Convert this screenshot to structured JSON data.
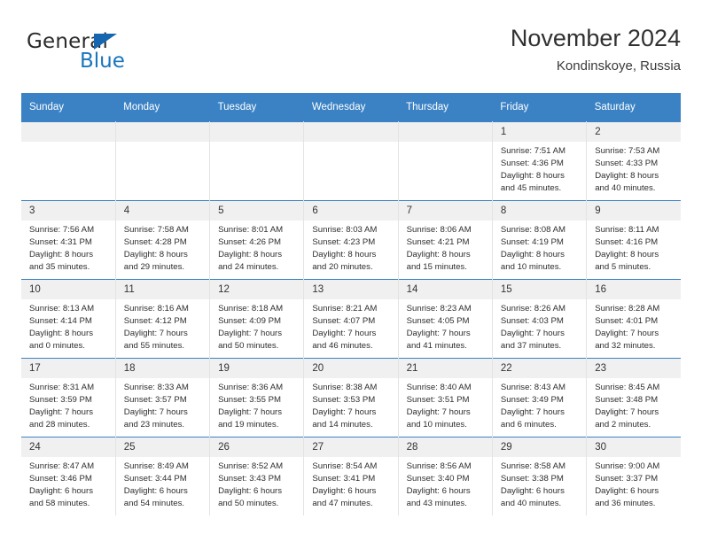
{
  "brand": {
    "word1": "General",
    "word2": "Blue",
    "triangle_color": "#1565b0",
    "blue_color": "#1976bd"
  },
  "header": {
    "title": "November 2024",
    "subtitle": "Kondinskoye, Russia"
  },
  "theme": {
    "header_blue": "#3b82c4",
    "daynum_bg": "#f0f0f0",
    "cell_border": "#e3e3e3"
  },
  "weekdays": [
    "Sunday",
    "Monday",
    "Tuesday",
    "Wednesday",
    "Thursday",
    "Friday",
    "Saturday"
  ],
  "weeks": [
    [
      {
        "day": "",
        "empty": true
      },
      {
        "day": "",
        "empty": true
      },
      {
        "day": "",
        "empty": true
      },
      {
        "day": "",
        "empty": true
      },
      {
        "day": "",
        "empty": true
      },
      {
        "day": "1",
        "sunrise": "Sunrise: 7:51 AM",
        "sunset": "Sunset: 4:36 PM",
        "daylight1": "Daylight: 8 hours",
        "daylight2": "and 45 minutes."
      },
      {
        "day": "2",
        "sunrise": "Sunrise: 7:53 AM",
        "sunset": "Sunset: 4:33 PM",
        "daylight1": "Daylight: 8 hours",
        "daylight2": "and 40 minutes."
      }
    ],
    [
      {
        "day": "3",
        "sunrise": "Sunrise: 7:56 AM",
        "sunset": "Sunset: 4:31 PM",
        "daylight1": "Daylight: 8 hours",
        "daylight2": "and 35 minutes."
      },
      {
        "day": "4",
        "sunrise": "Sunrise: 7:58 AM",
        "sunset": "Sunset: 4:28 PM",
        "daylight1": "Daylight: 8 hours",
        "daylight2": "and 29 minutes."
      },
      {
        "day": "5",
        "sunrise": "Sunrise: 8:01 AM",
        "sunset": "Sunset: 4:26 PM",
        "daylight1": "Daylight: 8 hours",
        "daylight2": "and 24 minutes."
      },
      {
        "day": "6",
        "sunrise": "Sunrise: 8:03 AM",
        "sunset": "Sunset: 4:23 PM",
        "daylight1": "Daylight: 8 hours",
        "daylight2": "and 20 minutes."
      },
      {
        "day": "7",
        "sunrise": "Sunrise: 8:06 AM",
        "sunset": "Sunset: 4:21 PM",
        "daylight1": "Daylight: 8 hours",
        "daylight2": "and 15 minutes."
      },
      {
        "day": "8",
        "sunrise": "Sunrise: 8:08 AM",
        "sunset": "Sunset: 4:19 PM",
        "daylight1": "Daylight: 8 hours",
        "daylight2": "and 10 minutes."
      },
      {
        "day": "9",
        "sunrise": "Sunrise: 8:11 AM",
        "sunset": "Sunset: 4:16 PM",
        "daylight1": "Daylight: 8 hours",
        "daylight2": "and 5 minutes."
      }
    ],
    [
      {
        "day": "10",
        "sunrise": "Sunrise: 8:13 AM",
        "sunset": "Sunset: 4:14 PM",
        "daylight1": "Daylight: 8 hours",
        "daylight2": "and 0 minutes."
      },
      {
        "day": "11",
        "sunrise": "Sunrise: 8:16 AM",
        "sunset": "Sunset: 4:12 PM",
        "daylight1": "Daylight: 7 hours",
        "daylight2": "and 55 minutes."
      },
      {
        "day": "12",
        "sunrise": "Sunrise: 8:18 AM",
        "sunset": "Sunset: 4:09 PM",
        "daylight1": "Daylight: 7 hours",
        "daylight2": "and 50 minutes."
      },
      {
        "day": "13",
        "sunrise": "Sunrise: 8:21 AM",
        "sunset": "Sunset: 4:07 PM",
        "daylight1": "Daylight: 7 hours",
        "daylight2": "and 46 minutes."
      },
      {
        "day": "14",
        "sunrise": "Sunrise: 8:23 AM",
        "sunset": "Sunset: 4:05 PM",
        "daylight1": "Daylight: 7 hours",
        "daylight2": "and 41 minutes."
      },
      {
        "day": "15",
        "sunrise": "Sunrise: 8:26 AM",
        "sunset": "Sunset: 4:03 PM",
        "daylight1": "Daylight: 7 hours",
        "daylight2": "and 37 minutes."
      },
      {
        "day": "16",
        "sunrise": "Sunrise: 8:28 AM",
        "sunset": "Sunset: 4:01 PM",
        "daylight1": "Daylight: 7 hours",
        "daylight2": "and 32 minutes."
      }
    ],
    [
      {
        "day": "17",
        "sunrise": "Sunrise: 8:31 AM",
        "sunset": "Sunset: 3:59 PM",
        "daylight1": "Daylight: 7 hours",
        "daylight2": "and 28 minutes."
      },
      {
        "day": "18",
        "sunrise": "Sunrise: 8:33 AM",
        "sunset": "Sunset: 3:57 PM",
        "daylight1": "Daylight: 7 hours",
        "daylight2": "and 23 minutes."
      },
      {
        "day": "19",
        "sunrise": "Sunrise: 8:36 AM",
        "sunset": "Sunset: 3:55 PM",
        "daylight1": "Daylight: 7 hours",
        "daylight2": "and 19 minutes."
      },
      {
        "day": "20",
        "sunrise": "Sunrise: 8:38 AM",
        "sunset": "Sunset: 3:53 PM",
        "daylight1": "Daylight: 7 hours",
        "daylight2": "and 14 minutes."
      },
      {
        "day": "21",
        "sunrise": "Sunrise: 8:40 AM",
        "sunset": "Sunset: 3:51 PM",
        "daylight1": "Daylight: 7 hours",
        "daylight2": "and 10 minutes."
      },
      {
        "day": "22",
        "sunrise": "Sunrise: 8:43 AM",
        "sunset": "Sunset: 3:49 PM",
        "daylight1": "Daylight: 7 hours",
        "daylight2": "and 6 minutes."
      },
      {
        "day": "23",
        "sunrise": "Sunrise: 8:45 AM",
        "sunset": "Sunset: 3:48 PM",
        "daylight1": "Daylight: 7 hours",
        "daylight2": "and 2 minutes."
      }
    ],
    [
      {
        "day": "24",
        "sunrise": "Sunrise: 8:47 AM",
        "sunset": "Sunset: 3:46 PM",
        "daylight1": "Daylight: 6 hours",
        "daylight2": "and 58 minutes."
      },
      {
        "day": "25",
        "sunrise": "Sunrise: 8:49 AM",
        "sunset": "Sunset: 3:44 PM",
        "daylight1": "Daylight: 6 hours",
        "daylight2": "and 54 minutes."
      },
      {
        "day": "26",
        "sunrise": "Sunrise: 8:52 AM",
        "sunset": "Sunset: 3:43 PM",
        "daylight1": "Daylight: 6 hours",
        "daylight2": "and 50 minutes."
      },
      {
        "day": "27",
        "sunrise": "Sunrise: 8:54 AM",
        "sunset": "Sunset: 3:41 PM",
        "daylight1": "Daylight: 6 hours",
        "daylight2": "and 47 minutes."
      },
      {
        "day": "28",
        "sunrise": "Sunrise: 8:56 AM",
        "sunset": "Sunset: 3:40 PM",
        "daylight1": "Daylight: 6 hours",
        "daylight2": "and 43 minutes."
      },
      {
        "day": "29",
        "sunrise": "Sunrise: 8:58 AM",
        "sunset": "Sunset: 3:38 PM",
        "daylight1": "Daylight: 6 hours",
        "daylight2": "and 40 minutes."
      },
      {
        "day": "30",
        "sunrise": "Sunrise: 9:00 AM",
        "sunset": "Sunset: 3:37 PM",
        "daylight1": "Daylight: 6 hours",
        "daylight2": "and 36 minutes."
      }
    ]
  ]
}
